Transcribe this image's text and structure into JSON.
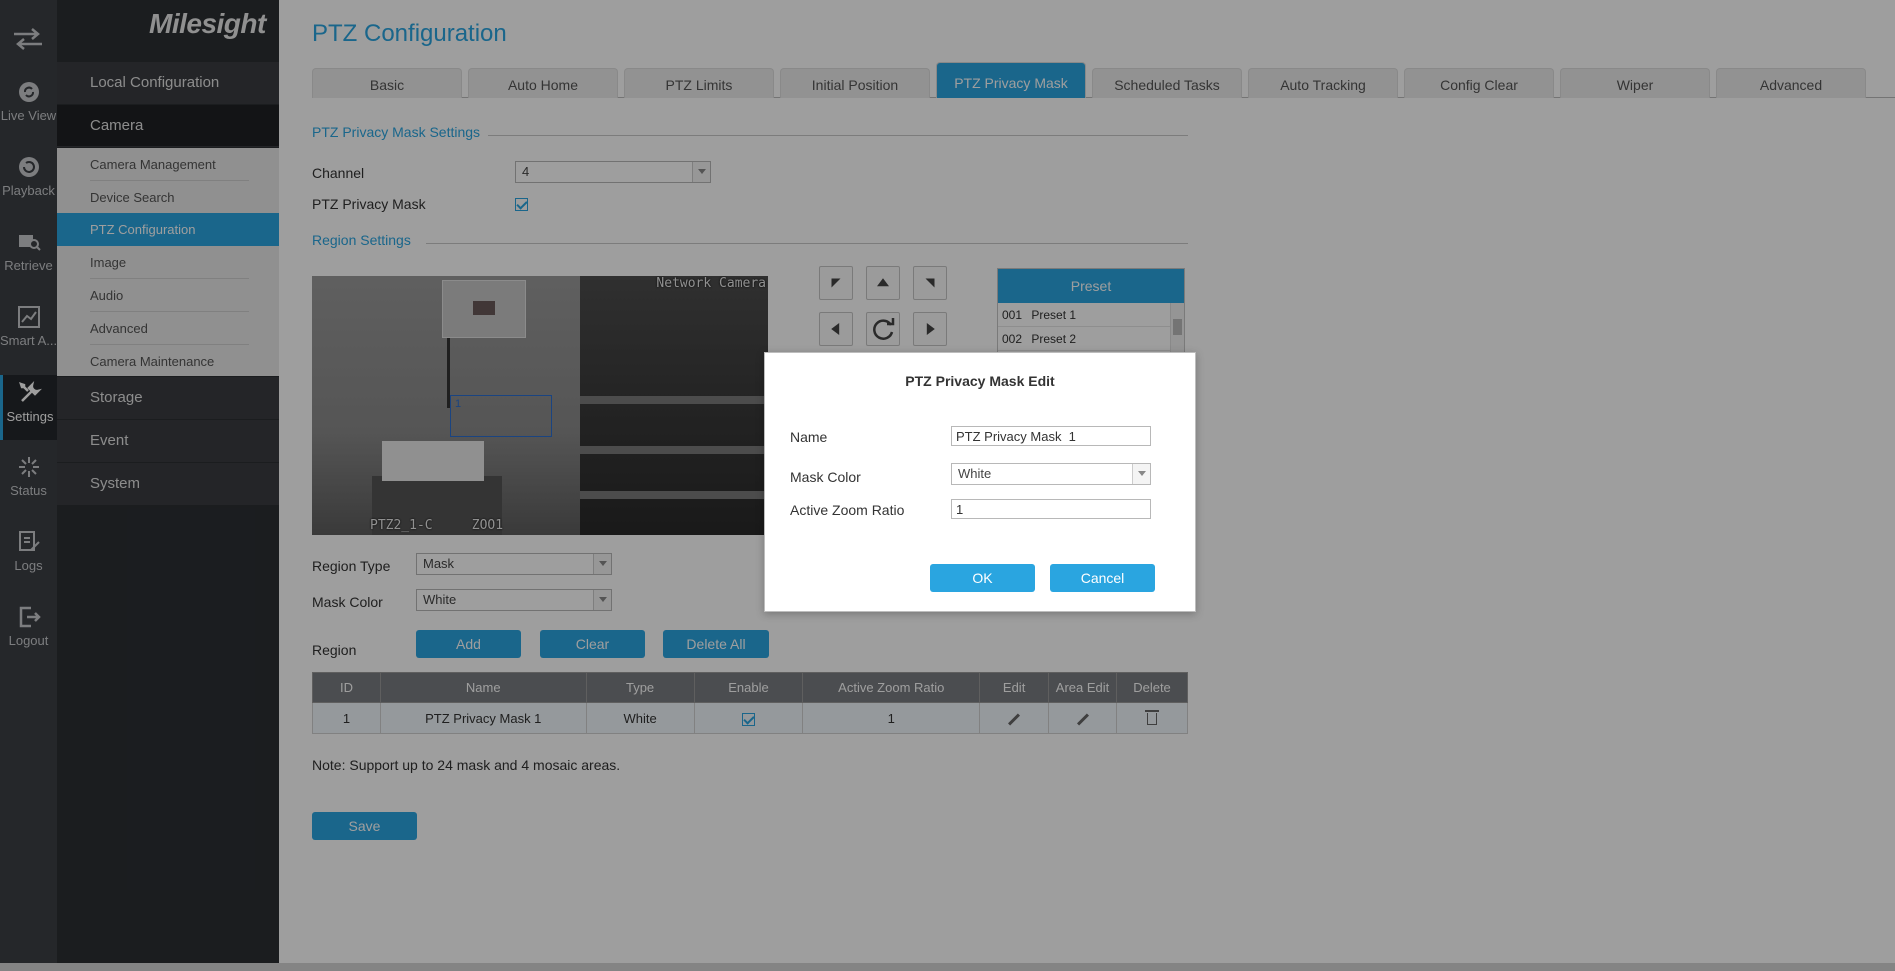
{
  "rail": {
    "items": [
      {
        "label": "Live View",
        "icon": "live-view-icon"
      },
      {
        "label": "Playback",
        "icon": "playback-icon"
      },
      {
        "label": "Retrieve",
        "icon": "retrieve-icon"
      },
      {
        "label": "Smart A...",
        "icon": "smart-analytics-icon"
      },
      {
        "label": "Settings",
        "icon": "settings-icon"
      },
      {
        "label": "Status",
        "icon": "status-icon"
      },
      {
        "label": "Logs",
        "icon": "logs-icon"
      },
      {
        "label": "Logout",
        "icon": "logout-icon"
      }
    ]
  },
  "brand": "Milesight",
  "menu": {
    "local_configuration": "Local Configuration",
    "camera": "Camera",
    "sub": [
      "Camera Management",
      "Device Search",
      "PTZ Configuration",
      "Image",
      "Audio",
      "Advanced",
      "Camera Maintenance"
    ],
    "storage": "Storage",
    "event": "Event",
    "system": "System"
  },
  "page": {
    "title": "PTZ Configuration",
    "tabs": [
      "Basic",
      "Auto Home",
      "PTZ Limits",
      "Initial Position",
      "PTZ Privacy Mask",
      "Scheduled Tasks",
      "Auto Tracking",
      "Config Clear",
      "Wiper",
      "Advanced"
    ],
    "active_tab": "PTZ Privacy Mask"
  },
  "mask_settings": {
    "section_title": "PTZ Privacy Mask Settings",
    "channel_label": "Channel",
    "channel_value": "4",
    "privacy_mask_label": "PTZ Privacy Mask",
    "privacy_mask_checked": true
  },
  "region": {
    "section_title": "Region Settings",
    "osd_top": "Network Camera",
    "osd_bottom": "PTZ2_1-C     ZOO1",
    "sel_label": "1",
    "region_type_label": "Region Type",
    "region_type_value": "Mask",
    "mask_color_label": "Mask Color",
    "mask_color_value": "White",
    "region_label": "Region",
    "add_btn": "Add",
    "clear_btn": "Clear",
    "delete_all_btn": "Delete All"
  },
  "preset": {
    "header": "Preset",
    "rows": [
      {
        "num": "001",
        "name": "Preset 1"
      },
      {
        "num": "002",
        "name": "Preset 2"
      }
    ]
  },
  "table": {
    "headers": [
      "ID",
      "Name",
      "Type",
      "Enable",
      "Active Zoom Ratio",
      "Edit",
      "Area Edit",
      "Delete"
    ],
    "rows": [
      {
        "id": "1",
        "name": "PTZ Privacy Mask 1",
        "type": "White",
        "enable": true,
        "zoom": "1"
      }
    ]
  },
  "note": "Note: Support up to 24 mask and 4 mosaic areas.",
  "save_btn": "Save",
  "dialog": {
    "title": "PTZ Privacy Mask Edit",
    "name_label": "Name",
    "name_value": "PTZ Privacy Mask  1",
    "mask_color_label": "Mask Color",
    "mask_color_value": "White",
    "zoom_label": "Active Zoom Ratio",
    "zoom_value": "1",
    "ok": "OK",
    "cancel": "Cancel"
  },
  "colors": {
    "accent": "#2aa5e0",
    "rail": "#3c3f44",
    "menu": "#2c2f33"
  }
}
